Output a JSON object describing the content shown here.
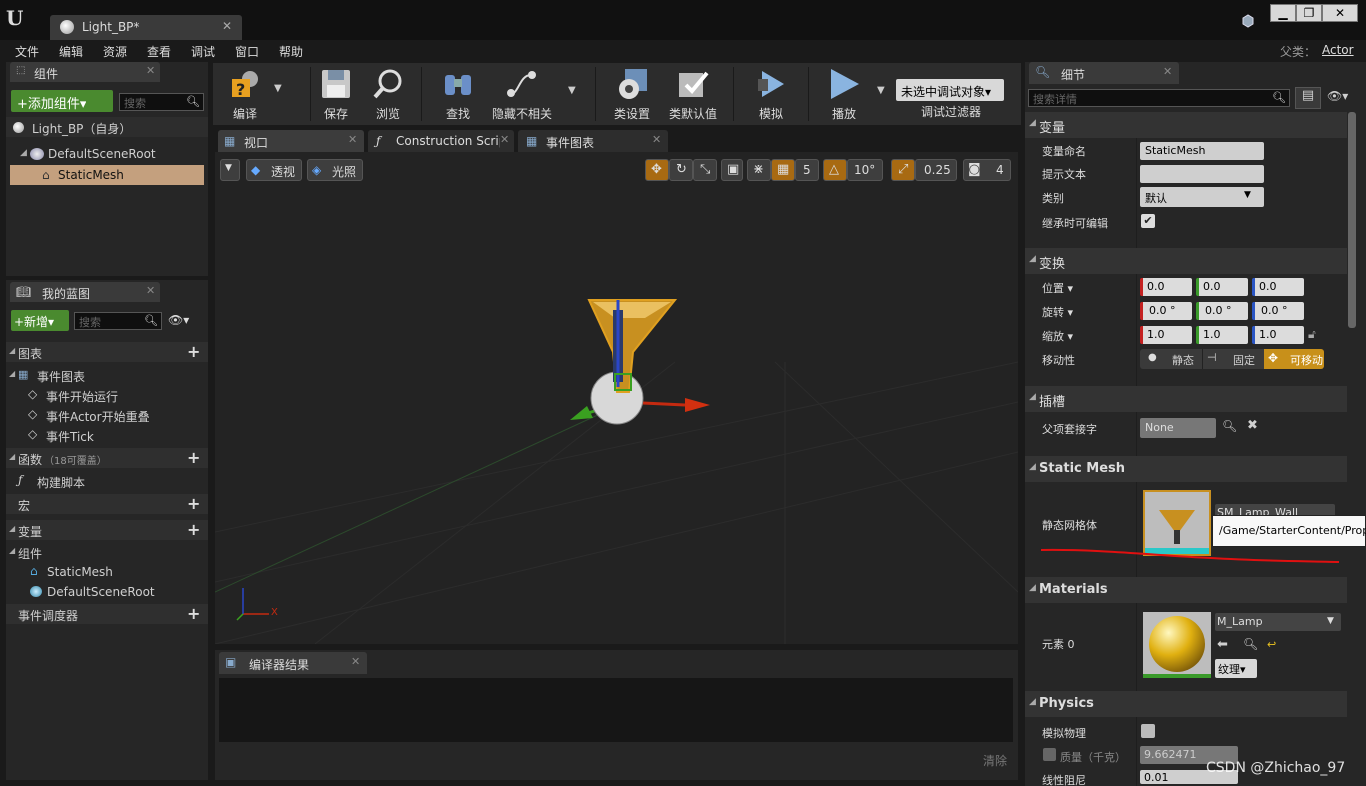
{
  "window": {
    "doc_tab": "Light_BP*",
    "min": "▁",
    "max": "❐",
    "close": "✕"
  },
  "menu": [
    "文件",
    "编辑",
    "资源",
    "查看",
    "调试",
    "窗口",
    "帮助"
  ],
  "parent_class_label": "父类：",
  "parent_class": "Actor",
  "components_panel": {
    "tab": "组件",
    "add_button": "+添加组件▾",
    "search_placeholder": "搜索",
    "self_item": "Light_BP（自身）",
    "tree": [
      "DefaultSceneRoot",
      "StaticMesh"
    ]
  },
  "blueprint_panel": {
    "tab": "我的蓝图",
    "new_button": "+新增▾",
    "search_placeholder": "搜索",
    "graphs_header": "图表",
    "event_graph": "事件图表",
    "events": [
      "事件开始运行",
      "事件Actor开始重叠",
      "事件Tick"
    ],
    "functions_header": "函数",
    "functions_note": "（18可覆盖）",
    "construction_script": "构建脚本",
    "macros_header": "宏",
    "variables_header": "变量",
    "components_header": "组件",
    "components": [
      "StaticMesh",
      "DefaultSceneRoot"
    ],
    "dispatchers_header": "事件调度器"
  },
  "toolbar": {
    "compile": "编译",
    "save": "保存",
    "browse": "浏览",
    "find": "查找",
    "hide_unrelated": "隐藏不相关",
    "class_settings": "类设置",
    "class_defaults": "类默认值",
    "simulate": "模拟",
    "play": "播放",
    "debug_object": "未选中调试对象▾",
    "debug_filter": "调试过滤器"
  },
  "editor_tabs": [
    "视口",
    "Construction Scrip",
    "事件图表"
  ],
  "viewport": {
    "perspective": "透视",
    "lit": "光照",
    "grid_snap": "5",
    "rot_snap": "10°",
    "scale_snap": "0.25",
    "cam_speed": "4",
    "axis_x": "X"
  },
  "compiler": {
    "tab": "编译器结果",
    "clear": "清除"
  },
  "details": {
    "tab": "细节",
    "search_placeholder": "搜索详情",
    "variable_section": "变量",
    "var_name_label": "变量命名",
    "var_name": "StaticMesh",
    "tooltip_label": "提示文本",
    "category_label": "类别",
    "category": "默认",
    "editable_label": "继承时可编辑",
    "transform_section": "变换",
    "location_label": "位置 ▾",
    "rotation_label": "旋转 ▾",
    "scale_label": "缩放 ▾",
    "location": [
      "0.0",
      "0.0",
      "0.0"
    ],
    "rotation": [
      "0.0 °",
      "0.0 °",
      "0.0 °"
    ],
    "scale": [
      "1.0",
      "1.0",
      "1.0"
    ],
    "mobility_label": "移动性",
    "mobility": [
      "静态",
      "固定",
      "可移动"
    ],
    "sockets_section": "插槽",
    "parent_socket_label": "父项套接字",
    "parent_socket": "None",
    "static_mesh_section": "Static Mesh",
    "static_mesh_label": "静态网格体",
    "static_mesh_value": "SM_Lamp_Wall",
    "static_mesh_path": "/Game/StarterContent/Props",
    "materials_section": "Materials",
    "element_label": "元素 0",
    "material_value": "M_Lamp",
    "texture_button": "纹理▾",
    "physics_section": "Physics",
    "simulate_physics_label": "模拟物理",
    "mass_label": "质量（千克）",
    "mass_value": "9.662471",
    "damping_label": "线性阻尼",
    "damping_value": "0.01"
  },
  "watermark": "CSDN @Zhichao_97"
}
